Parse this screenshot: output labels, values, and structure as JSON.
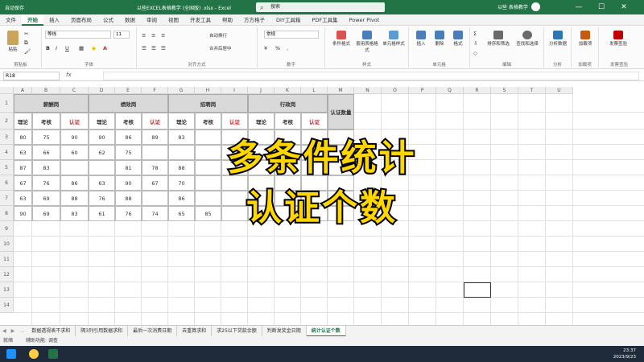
{
  "titlebar": {
    "autosave": "自动保存",
    "doc_title": "以些EXCEL表格教学 (全国版) .xlsx - Excel",
    "search_placeholder": "搜索",
    "user": "以些 表格教学",
    "min": "—",
    "max": "☐",
    "close": "✕"
  },
  "tabs": [
    "文件",
    "开始",
    "插入",
    "页面布局",
    "公式",
    "数据",
    "审阅",
    "视图",
    "开发工具",
    "帮助",
    "方方格子",
    "DIY工具箱",
    "PDF工具集",
    "Power Pivot"
  ],
  "ribbon": {
    "clipboard": {
      "label": "剪贴板",
      "paste": "粘贴"
    },
    "font": {
      "label": "字体",
      "name": "等线",
      "size": "11",
      "bold": "B",
      "italic": "I",
      "underline": "U"
    },
    "alignment": {
      "label": "对齐方式",
      "wrap": "自动换行",
      "merge": "合并后居中"
    },
    "number": {
      "label": "数字",
      "format": "常规"
    },
    "styles": {
      "label": "样式",
      "cond": "条件格式",
      "table": "套用表格格式",
      "cell": "单元格样式"
    },
    "cells": {
      "label": "单元格",
      "insert": "插入",
      "delete": "删除",
      "format": "格式"
    },
    "editing": {
      "label": "编辑",
      "sort": "排序和筛选",
      "find": "查找和选择"
    },
    "analysis": {
      "label": "分析",
      "analyze": "分析数据"
    },
    "addins": {
      "label": "加载项",
      "addin": "加载项"
    },
    "invoice": {
      "label": "发票查验",
      "check": "发票查验"
    }
  },
  "formulabar": {
    "namebox": "R18",
    "fx": "fx",
    "value": ""
  },
  "columns": [
    "A",
    "B",
    "C",
    "D",
    "E",
    "F",
    "G",
    "H",
    "I",
    "J",
    "K",
    "L",
    "M",
    "N",
    "O",
    "P",
    "Q",
    "R",
    "S",
    "T",
    "U"
  ],
  "rows": [
    "1",
    "2",
    "3",
    "4",
    "5",
    "6",
    "7",
    "8",
    "9",
    "10",
    "11",
    "12",
    "13",
    "14"
  ],
  "table": {
    "groups": [
      "薪酬岗",
      "绩效岗",
      "招聘岗",
      "行政岗"
    ],
    "count_header": "认证数量",
    "subheaders": [
      "理论",
      "考核",
      "认证",
      "理论",
      "考核",
      "认证",
      "理论",
      "考核",
      "认证",
      "理论",
      "考核",
      "认证"
    ],
    "data": [
      [
        "80",
        "75",
        "90",
        "90",
        "86",
        "89",
        "83",
        "",
        "",
        "",
        "",
        ""
      ],
      [
        "63",
        "66",
        "60",
        "62",
        "75",
        "",
        "",
        "",
        "",
        "",
        "",
        ""
      ],
      [
        "87",
        "83",
        "",
        "",
        "81",
        "78",
        "88",
        "",
        "",
        "",
        "",
        ""
      ],
      [
        "67",
        "76",
        "86",
        "63",
        "90",
        "67",
        "70",
        "",
        "",
        "",
        "",
        ""
      ],
      [
        "63",
        "69",
        "88",
        "76",
        "88",
        "",
        "86",
        "",
        "",
        "",
        "",
        ""
      ],
      [
        "90",
        "69",
        "83",
        "61",
        "76",
        "74",
        "65",
        "85",
        "",
        "",
        "",
        ""
      ]
    ]
  },
  "overlay": {
    "line1": "多条件统计",
    "line2": "认证个数"
  },
  "sheettabs": [
    "数据透视表不求和",
    "隔3列引用数据求和",
    "最后一次消费日期",
    "去重算求和",
    "求25以下贷款余额",
    "判断发奖金日期",
    "统计认证个数"
  ],
  "status": {
    "ready": "就绪",
    "accessibility": "辅助功能: 调查"
  },
  "clock": {
    "time": "23:37",
    "date": "2023/9/23"
  },
  "colors": {
    "excel_green": "#227346",
    "overlay_fill": "#ffd600",
    "overlay_stroke": "#000000",
    "accent_red": "#dd2222"
  }
}
